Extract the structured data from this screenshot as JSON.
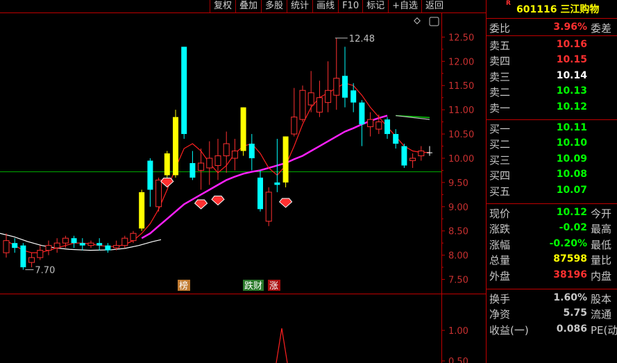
{
  "toolbar": [
    "复权",
    "叠加",
    "多股",
    "统计",
    "画线",
    "F10",
    "标记",
    "+自选",
    "返回"
  ],
  "header": {
    "r_badge": "R",
    "code": "601116",
    "name": "三江购物"
  },
  "colors": {
    "up": "#ff3030",
    "down": "#00ffff",
    "flat": "#ffffff",
    "neutral": "#c8c8c8",
    "yellow": "#ffff00",
    "green_text": "#00ff00",
    "red_text": "#ff3030",
    "ma_white": "#ffffff",
    "ma_red": "#ff2020",
    "ma_magenta": "#ff20ff",
    "ma_green": "#00cc00"
  },
  "order_book": {
    "ratio": {
      "label": "委比",
      "value": "3.96%",
      "label2": "委差"
    },
    "sells": [
      {
        "label": "卖五",
        "price": "10.16"
      },
      {
        "label": "卖四",
        "price": "10.15"
      },
      {
        "label": "卖三",
        "price": "10.14"
      },
      {
        "label": "卖二",
        "price": "10.13"
      },
      {
        "label": "卖一",
        "price": "10.12"
      }
    ],
    "buys": [
      {
        "label": "买一",
        "price": "10.11"
      },
      {
        "label": "买二",
        "price": "10.10"
      },
      {
        "label": "买三",
        "price": "10.09"
      },
      {
        "label": "买四",
        "price": "10.08"
      },
      {
        "label": "买五",
        "price": "10.07"
      }
    ]
  },
  "quote": [
    {
      "label": "现价",
      "value": "10.12",
      "label2": "今开"
    },
    {
      "label": "涨跌",
      "value": "-0.02",
      "label2": "最高"
    },
    {
      "label": "涨幅",
      "value": "-0.20%",
      "label2": "最低"
    },
    {
      "label": "总量",
      "value": "87598",
      "label2": "量比"
    },
    {
      "label": "外盘",
      "value": "38196",
      "label2": "内盘"
    }
  ],
  "stats": [
    {
      "label": "换手",
      "value": "1.60%",
      "label2": "股本"
    },
    {
      "label": "净资",
      "value": "5.75",
      "label2": "流通"
    },
    {
      "label": "收益(一)",
      "value": "0.086",
      "label2": "PE(动"
    }
  ],
  "chart_data": {
    "type": "candlestick",
    "y_ticks": [
      "12.50",
      "12.00",
      "11.50",
      "11.00",
      "10.50",
      "10.00",
      "9.50",
      "9.00",
      "8.50",
      "8.00",
      "7.50"
    ],
    "y_range": [
      7.25,
      12.95
    ],
    "high_mark": "12.48",
    "low_mark": "7.70",
    "reference_line": 9.72,
    "markers": [
      "榜",
      "跌财",
      "涨"
    ],
    "sub_y_ticks": [
      "1.00",
      "0.50"
    ],
    "candles": [
      {
        "o": 8.05,
        "c": 8.3,
        "h": 8.45,
        "l": 7.95,
        "t": "up"
      },
      {
        "o": 8.25,
        "c": 8.15,
        "h": 8.35,
        "l": 8.05,
        "t": "down"
      },
      {
        "o": 8.2,
        "c": 7.75,
        "h": 8.25,
        "l": 7.7,
        "t": "down"
      },
      {
        "o": 7.85,
        "c": 7.95,
        "h": 8.05,
        "l": 7.75,
        "t": "up"
      },
      {
        "o": 7.95,
        "c": 8.1,
        "h": 8.2,
        "l": 7.9,
        "t": "up"
      },
      {
        "o": 8.1,
        "c": 8.2,
        "h": 8.3,
        "l": 8.0,
        "t": "up"
      },
      {
        "o": 8.15,
        "c": 8.25,
        "h": 8.35,
        "l": 8.05,
        "t": "up"
      },
      {
        "o": 8.25,
        "c": 8.35,
        "h": 8.4,
        "l": 8.15,
        "t": "up"
      },
      {
        "o": 8.35,
        "c": 8.25,
        "h": 8.4,
        "l": 8.15,
        "t": "down"
      },
      {
        "o": 8.25,
        "c": 8.2,
        "h": 8.35,
        "l": 8.1,
        "t": "down"
      },
      {
        "o": 8.2,
        "c": 8.25,
        "h": 8.3,
        "l": 8.15,
        "t": "up"
      },
      {
        "o": 8.25,
        "c": 8.2,
        "h": 8.35,
        "l": 8.1,
        "t": "down"
      },
      {
        "o": 8.2,
        "c": 8.1,
        "h": 8.25,
        "l": 8.05,
        "t": "down"
      },
      {
        "o": 8.15,
        "c": 8.2,
        "h": 8.3,
        "l": 8.1,
        "t": "up"
      },
      {
        "o": 8.2,
        "c": 8.35,
        "h": 8.4,
        "l": 8.15,
        "t": "up"
      },
      {
        "o": 8.3,
        "c": 8.45,
        "h": 8.5,
        "l": 8.25,
        "t": "up"
      },
      {
        "o": 8.55,
        "c": 9.3,
        "h": 9.35,
        "l": 8.5,
        "t": "yellow"
      },
      {
        "o": 9.35,
        "c": 9.95,
        "h": 10.0,
        "l": 9.0,
        "t": "down"
      },
      {
        "o": 9.0,
        "c": 9.55,
        "h": 9.6,
        "l": 8.9,
        "t": "up"
      },
      {
        "o": 9.65,
        "c": 10.1,
        "h": 10.15,
        "l": 9.6,
        "t": "yellow"
      },
      {
        "o": 10.85,
        "c": 9.65,
        "h": 11.0,
        "l": 9.6,
        "t": "yellow"
      },
      {
        "o": 12.3,
        "c": 10.5,
        "h": 12.3,
        "l": 10.4,
        "t": "down"
      },
      {
        "o": 9.9,
        "c": 9.6,
        "h": 10.15,
        "l": 9.55,
        "t": "down"
      },
      {
        "o": 9.75,
        "c": 9.9,
        "h": 10.2,
        "l": 9.35,
        "t": "up"
      },
      {
        "o": 9.8,
        "c": 10.0,
        "h": 10.35,
        "l": 9.45,
        "t": "up"
      },
      {
        "o": 9.85,
        "c": 10.05,
        "h": 10.4,
        "l": 9.55,
        "t": "up"
      },
      {
        "o": 10.05,
        "c": 10.3,
        "h": 10.55,
        "l": 9.7,
        "t": "up"
      },
      {
        "o": 10.0,
        "c": 10.15,
        "h": 10.4,
        "l": 9.75,
        "t": "up"
      },
      {
        "o": 11.05,
        "c": 10.15,
        "h": 11.05,
        "l": 10.05,
        "t": "yellow"
      },
      {
        "o": 10.3,
        "c": 10.0,
        "h": 10.5,
        "l": 9.75,
        "t": "down"
      },
      {
        "o": 9.6,
        "c": 8.95,
        "h": 9.75,
        "l": 8.9,
        "t": "down"
      },
      {
        "o": 8.7,
        "c": 9.3,
        "h": 9.4,
        "l": 8.6,
        "t": "up"
      },
      {
        "o": 9.5,
        "c": 9.45,
        "h": 10.4,
        "l": 9.3,
        "t": "down"
      },
      {
        "o": 10.45,
        "c": 9.5,
        "h": 10.45,
        "l": 9.4,
        "t": "yellow"
      },
      {
        "o": 10.5,
        "c": 10.85,
        "h": 11.45,
        "l": 10.45,
        "t": "up"
      },
      {
        "o": 10.8,
        "c": 11.4,
        "h": 11.5,
        "l": 10.75,
        "t": "up"
      },
      {
        "o": 11.1,
        "c": 11.35,
        "h": 11.8,
        "l": 10.95,
        "t": "up"
      },
      {
        "o": 10.95,
        "c": 11.25,
        "h": 11.6,
        "l": 10.85,
        "t": "up"
      },
      {
        "o": 11.15,
        "c": 11.4,
        "h": 12.0,
        "l": 10.95,
        "t": "up"
      },
      {
        "o": 11.3,
        "c": 11.65,
        "h": 12.48,
        "l": 11.0,
        "t": "up"
      },
      {
        "o": 11.7,
        "c": 11.25,
        "h": 12.3,
        "l": 11.05,
        "t": "down"
      },
      {
        "o": 11.4,
        "c": 11.15,
        "h": 11.55,
        "l": 10.95,
        "t": "down"
      },
      {
        "o": 11.15,
        "c": 10.7,
        "h": 11.2,
        "l": 10.25,
        "t": "down"
      },
      {
        "o": 10.65,
        "c": 10.8,
        "h": 10.95,
        "l": 10.45,
        "t": "up"
      },
      {
        "o": 10.6,
        "c": 10.75,
        "h": 10.9,
        "l": 10.5,
        "t": "up"
      },
      {
        "o": 10.8,
        "c": 10.5,
        "h": 10.85,
        "l": 10.4,
        "t": "down"
      },
      {
        "o": 10.5,
        "c": 10.3,
        "h": 10.6,
        "l": 10.2,
        "t": "down"
      },
      {
        "o": 10.25,
        "c": 9.85,
        "h": 10.3,
        "l": 9.8,
        "t": "down"
      },
      {
        "o": 10.0,
        "c": 9.95,
        "h": 10.1,
        "l": 9.8,
        "t": "up"
      },
      {
        "o": 10.05,
        "c": 10.15,
        "h": 10.25,
        "l": 9.95,
        "t": "up"
      },
      {
        "o": 10.12,
        "c": 10.12,
        "h": 10.25,
        "l": 10.05,
        "t": "flat"
      }
    ],
    "ma_white": [
      8.45,
      8.4,
      8.32,
      8.24,
      8.18,
      8.15,
      8.13,
      8.12,
      8.12,
      8.12,
      8.12,
      8.12,
      8.12,
      8.13,
      8.14,
      8.16,
      8.2,
      8.25,
      8.32
    ],
    "ma_red": [
      8.3,
      8.2,
      8.1,
      8.05,
      8.05,
      8.1,
      8.15,
      8.2,
      8.25,
      8.25,
      8.23,
      8.2,
      8.18,
      8.18,
      8.22,
      8.3,
      8.45,
      8.65,
      8.95,
      9.35,
      9.8,
      10.2,
      10.3,
      10.15,
      9.9,
      9.7,
      9.85,
      10.1,
      10.25,
      10.3,
      10.1,
      9.8,
      9.65,
      9.85,
      10.25,
      10.7,
      11.05,
      11.25,
      11.35,
      11.45,
      11.55,
      11.5,
      11.3,
      11.05,
      10.85,
      10.65,
      10.45,
      10.25,
      10.15,
      10.12,
      10.12
    ],
    "ma_magenta_start": 16,
    "ma_magenta": [
      8.35,
      8.45,
      8.6,
      8.75,
      8.9,
      9.05,
      9.15,
      9.25,
      9.35,
      9.45,
      9.55,
      9.62,
      9.68,
      9.72,
      9.75,
      9.8,
      9.85,
      9.9,
      9.98,
      10.05,
      10.15,
      10.25,
      10.35,
      10.45,
      10.55,
      10.62,
      10.7,
      10.77,
      10.83,
      10.88
    ],
    "ma_green_start": 46,
    "ma_green": [
      10.88,
      10.87,
      10.86,
      10.85,
      10.84
    ],
    "diamonds": [
      {
        "i": 19,
        "y": 9.52
      },
      {
        "i": 23,
        "y": 9.07
      },
      {
        "i": 25,
        "y": 9.15
      },
      {
        "i": 33,
        "y": 9.1
      }
    ]
  }
}
